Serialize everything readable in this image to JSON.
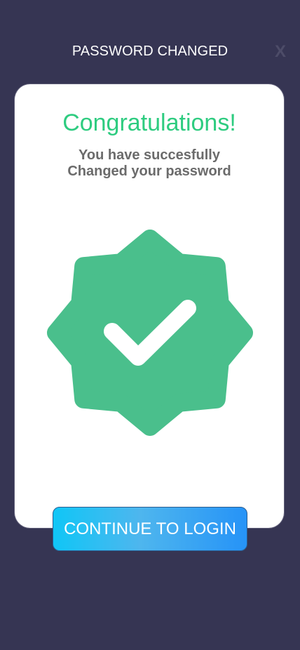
{
  "header": {
    "title": "PASSWORD CHANGED",
    "close_label": "X"
  },
  "card": {
    "heading": "Congratulations!",
    "message_line1": "You have succesfully",
    "message_line2": "Changed your password",
    "badge_icon": "verified-check-badge-icon"
  },
  "actions": {
    "continue_label": "CONTINUE TO LOGIN"
  },
  "colors": {
    "background": "#363553",
    "card": "#ffffff",
    "accent_green": "#2ecc80",
    "badge_green": "#4abf8c",
    "button_gradient_start": "#10c6f6",
    "button_gradient_end": "#2693f7"
  }
}
